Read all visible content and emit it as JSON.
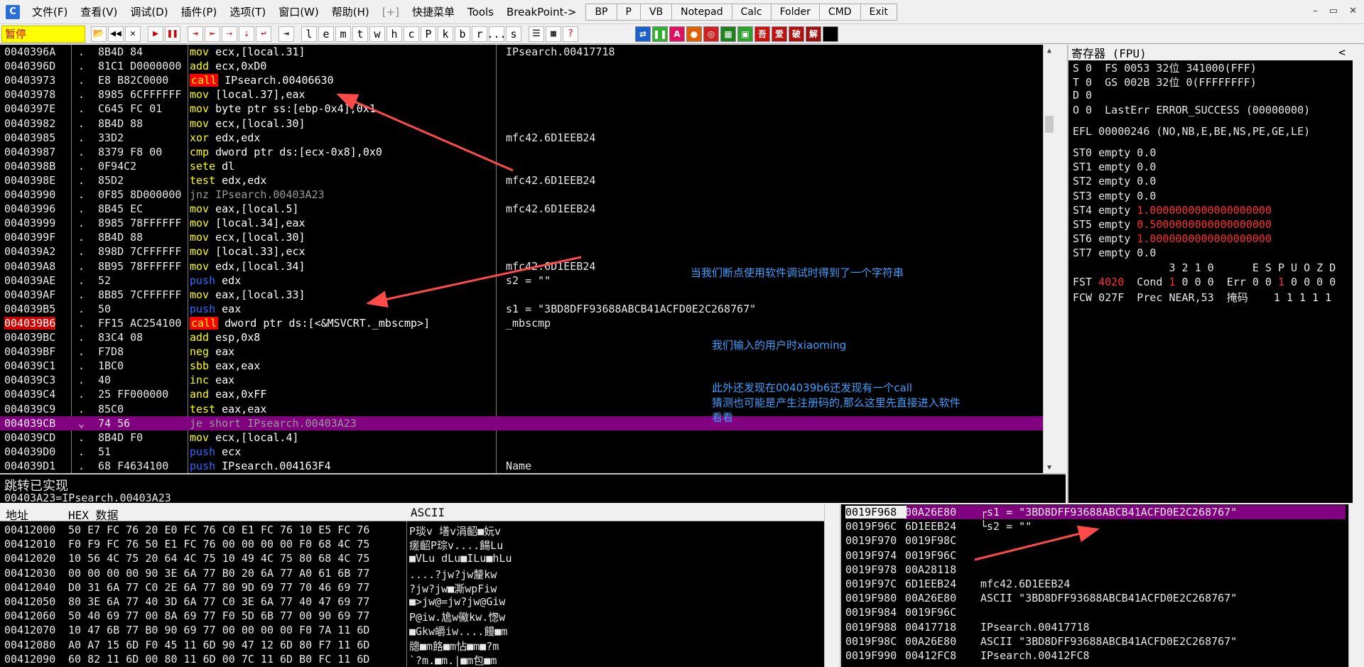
{
  "menubar": {
    "app_icon": "C",
    "items": [
      "文件(F)",
      "查看(V)",
      "调试(D)",
      "插件(P)",
      "选项(T)",
      "窗口(W)",
      "帮助(H)",
      "[+]",
      "快捷菜单",
      "Tools",
      "BreakPoint->"
    ],
    "quick_tabs": [
      "BP",
      "P",
      "VB",
      "Notepad",
      "Calc",
      "Folder",
      "CMD",
      "Exit"
    ],
    "window_controls": [
      "–",
      "▭",
      "✕"
    ]
  },
  "toolbar": {
    "status": "暂停",
    "buttons": [
      "📂",
      "◀◀",
      "✕",
      "▶",
      "❚❚",
      "⇥",
      "⇤",
      "⇢",
      "⇣",
      "↩",
      "⇥"
    ],
    "letters": [
      "l",
      "e",
      "m",
      "t",
      "w",
      "h",
      "c",
      "P",
      "k",
      "b",
      "r",
      "...",
      "s"
    ],
    "extra": [
      "☰",
      "▦",
      "?"
    ],
    "color_buttons": [
      {
        "label": "⇄",
        "color": "#1a5fd0"
      },
      {
        "label": "❚❚",
        "color": "#30b030"
      },
      {
        "label": "A",
        "color": "#e01060"
      },
      {
        "label": "●",
        "color": "#e06000"
      },
      {
        "label": "◎",
        "color": "#d02020"
      },
      {
        "label": "▦",
        "color": "#208020"
      },
      {
        "label": "▣",
        "color": "#30a030"
      },
      {
        "label": "吾",
        "color": "#d01010"
      },
      {
        "label": "爱",
        "color": "#c01010"
      },
      {
        "label": "破",
        "color": "#b01010"
      },
      {
        "label": "解",
        "color": "#a01010"
      },
      {
        "label": "",
        "color": "#000000"
      }
    ]
  },
  "disasm": {
    "rows": [
      {
        "addr": "0040396A",
        "mark": ".",
        "hex": "8B4D 84",
        "mn": "mov",
        "kind": "mov",
        "op": "ecx,[local.31]",
        "cmt": "IPsearch.00417718"
      },
      {
        "addr": "0040396D",
        "mark": ".",
        "hex": "81C1 D0000000",
        "mn": "add",
        "kind": "mov",
        "op": "ecx,0xD0",
        "cmt": ""
      },
      {
        "addr": "00403973",
        "mark": ".",
        "hex": "E8 B82C0000",
        "mn": "call",
        "kind": "call",
        "op": "IPsearch.00406630",
        "cmt": ""
      },
      {
        "addr": "00403978",
        "mark": ".",
        "hex": "8985 6CFFFFFF",
        "mn": "mov",
        "kind": "mov",
        "op": "[local.37],eax",
        "cmt": ""
      },
      {
        "addr": "0040397E",
        "mark": ".",
        "hex": "C645 FC 01",
        "mn": "mov",
        "kind": "mov",
        "op": "byte ptr ss:[ebp-0x4],0x1",
        "cmt": ""
      },
      {
        "addr": "00403982",
        "mark": ".",
        "hex": "8B4D 88",
        "mn": "mov",
        "kind": "mov",
        "op": "ecx,[local.30]",
        "cmt": ""
      },
      {
        "addr": "00403985",
        "mark": ".",
        "hex": "33D2",
        "mn": "xor",
        "kind": "mov",
        "op": "edx,edx",
        "cmt": "mfc42.6D1EEB24"
      },
      {
        "addr": "00403987",
        "mark": ".",
        "hex": "8379 F8 00",
        "mn": "cmp",
        "kind": "mov",
        "op": "dword ptr ds:[ecx-0x8],0x0",
        "cmt": ""
      },
      {
        "addr": "0040398B",
        "mark": ".",
        "hex": "0F94C2",
        "mn": "sete",
        "kind": "mov",
        "op": "dl",
        "cmt": ""
      },
      {
        "addr": "0040398E",
        "mark": ".",
        "hex": "85D2",
        "mn": "test",
        "kind": "mov",
        "op": "edx,edx",
        "cmt": "mfc42.6D1EEB24"
      },
      {
        "addr": "00403990",
        "mark": ".",
        "hex": "0F85 8D000000",
        "mn": "jnz",
        "kind": "jmp",
        "op": "IPsearch.00403A23",
        "cmt": ""
      },
      {
        "addr": "00403996",
        "mark": ".",
        "hex": "8B45 EC",
        "mn": "mov",
        "kind": "mov",
        "op": "eax,[local.5]",
        "cmt": "mfc42.6D1EEB24"
      },
      {
        "addr": "00403999",
        "mark": ".",
        "hex": "8985 78FFFFFF",
        "mn": "mov",
        "kind": "mov",
        "op": "[local.34],eax",
        "cmt": ""
      },
      {
        "addr": "0040399F",
        "mark": ".",
        "hex": "8B4D 88",
        "mn": "mov",
        "kind": "mov",
        "op": "ecx,[local.30]",
        "cmt": ""
      },
      {
        "addr": "004039A2",
        "mark": ".",
        "hex": "898D 7CFFFFFF",
        "mn": "mov",
        "kind": "mov",
        "op": "[local.33],ecx",
        "cmt": ""
      },
      {
        "addr": "004039A8",
        "mark": ".",
        "hex": "8B95 78FFFFFF",
        "mn": "mov",
        "kind": "mov",
        "op": "edx,[local.34]",
        "cmt": "mfc42.6D1EEB24"
      },
      {
        "addr": "004039AE",
        "mark": ".",
        "hex": "52",
        "mn": "push",
        "kind": "push",
        "op": "edx",
        "cmt": "s2 = \"\""
      },
      {
        "addr": "004039AF",
        "mark": ".",
        "hex": "8B85 7CFFFFFF",
        "mn": "mov",
        "kind": "mov",
        "op": "eax,[local.33]",
        "cmt": ""
      },
      {
        "addr": "004039B5",
        "mark": ".",
        "hex": "50",
        "mn": "push",
        "kind": "push",
        "op": "eax",
        "cmt": "s1 = \"3BD8DFF93688ABCB41ACFD0E2C268767\""
      },
      {
        "addr": "004039B6",
        "mark": ".",
        "hex": "FF15 AC254100",
        "mn": "call",
        "kind": "call",
        "op": "dword ptr ds:[<&MSVCRT._mbscmp>]",
        "cmt": "_mbscmp",
        "bp": true
      },
      {
        "addr": "004039BC",
        "mark": ".",
        "hex": "83C4 08",
        "mn": "add",
        "kind": "mov",
        "op": "esp,0x8",
        "cmt": ""
      },
      {
        "addr": "004039BF",
        "mark": ".",
        "hex": "F7D8",
        "mn": "neg",
        "kind": "mov",
        "op": "eax",
        "cmt": ""
      },
      {
        "addr": "004039C1",
        "mark": ".",
        "hex": "1BC0",
        "mn": "sbb",
        "kind": "mov",
        "op": "eax,eax",
        "cmt": ""
      },
      {
        "addr": "004039C3",
        "mark": ".",
        "hex": "40",
        "mn": "inc",
        "kind": "mov",
        "op": "eax",
        "cmt": ""
      },
      {
        "addr": "004039C4",
        "mark": ".",
        "hex": "25 FF000000",
        "mn": "and",
        "kind": "mov",
        "op": "eax,0xFF",
        "cmt": ""
      },
      {
        "addr": "004039C9",
        "mark": ".",
        "hex": "85C0",
        "mn": "test",
        "kind": "mov",
        "op": "eax,eax",
        "cmt": ""
      },
      {
        "addr": "004039CB",
        "mark": "⌄",
        "hex": "74 56",
        "mn": "je",
        "kind": "jmp",
        "op": "short IPsearch.00403A23",
        "cmt": "",
        "sel": true
      },
      {
        "addr": "004039CD",
        "mark": ".",
        "hex": "8B4D F0",
        "mn": "mov",
        "kind": "mov",
        "op": "ecx,[local.4]",
        "cmt": ""
      },
      {
        "addr": "004039D0",
        "mark": ".",
        "hex": "51",
        "mn": "push",
        "kind": "push",
        "op": "ecx",
        "cmt": ""
      },
      {
        "addr": "004039D1",
        "mark": ".",
        "hex": "68 F4634100",
        "mn": "push",
        "kind": "push",
        "op": "IPsearch.004163F4",
        "cmt": "Name"
      }
    ],
    "annotations": [
      "当我们断点使用软件调试时得到了一个字符串",
      "我们输入的用户时xiaoming",
      "此外还发现在004039b6还发现有一个call",
      "猜测也可能是产生注册码的,那么这里先直接进入软件",
      "看看"
    ]
  },
  "info": {
    "line1": "跳转已实现",
    "line2": "00403A23=IPsearch.00403A23"
  },
  "registers": {
    "title": "寄存器 (FPU)",
    "collapse": "<",
    "lines": [
      "S 0  FS 0053 32位 341000(FFF)",
      "T 0  GS 002B 32位 0(FFFFFFFF)",
      "D 0",
      "O 0  LastErr ERROR_SUCCESS (00000000)",
      "",
      "EFL 00000246 (NO,NB,E,BE,NS,PE,GE,LE)",
      "",
      "ST0 empty 0.0",
      "ST1 empty 0.0",
      "ST2 empty 0.0",
      "ST3 empty 0.0"
    ],
    "fpu_red": [
      {
        "label": "ST4 empty ",
        "value": "1.0000000000000000000"
      },
      {
        "label": "ST5 empty ",
        "value": "0.5000000000000000000"
      },
      {
        "label": "ST6 empty ",
        "value": "1.0000000000000000000"
      }
    ],
    "st7": "ST7 empty 0.0",
    "bits_header": "               3 2 1 0      E S P U O Z D",
    "fst": {
      "pre": "FST ",
      "red": "4020",
      "mid": "  Cond ",
      "red2": "1",
      "mid2": " 0 0 0  Err 0 0 ",
      "red3": "1",
      "post": " 0 0 0 0"
    },
    "fcw": "FCW 027F  Prec NEAR,53  掩码    1 1 1 1 1"
  },
  "dump": {
    "headers": {
      "addr": "地址",
      "hex": "HEX 数据",
      "ascii": "ASCII"
    },
    "rows": [
      {
        "addr": "00412000",
        "hex": "50 E7 FC 76 20 E0 FC 76 C0 E1 FC 76 10 E5 FC 76",
        "ascii": "P琰v 墡v涓齠■妧v"
      },
      {
        "addr": "00412010",
        "hex": "F0 F9 FC 76 50 E1 FC 76 00 00 00 00 F0 68 4C 75",
        "ascii": "瘥齠P琮v....餳Lu"
      },
      {
        "addr": "00412020",
        "hex": "10 56 4C 75 20 64 4C 75 10 49 4C 75 80 68 4C 75",
        "ascii": "■VLu dLu■ILu■hLu"
      },
      {
        "addr": "00412030",
        "hex": "00 00 00 00 90 3E 6A 77 B0 20 6A 77 A0 61 6B 77",
        "ascii": "....?jw?jw釐kw"
      },
      {
        "addr": "00412040",
        "hex": "D0 31 6A 77 C0 2E 6A 77 80 9D 69 77 70 46 69 77",
        "ascii": "?jw?jw■澌wpFiw"
      },
      {
        "addr": "00412050",
        "hex": "80 3E 6A 77 40 3D 6A 77 C0 3E 6A 77 40 47 69 77",
        "ascii": "■>jw@=jw?jw@Giw"
      },
      {
        "addr": "00412060",
        "hex": "50 40 69 77 00 8A 69 77 F0 5D 6B 77 00 90 69 77",
        "ascii": "P@iw.尯w鰴kw.愡w"
      },
      {
        "addr": "00412070",
        "hex": "10 47 6B 77 B0 90 69 77 00 00 00 00 F0 7A 11 6D",
        "ascii": "■Gkw皭iw....饅■m"
      },
      {
        "addr": "00412080",
        "hex": "A0 A7 15 6D F0 45 11 6D 90 47 12 6D 80 F7 11 6D",
        "ascii": "牕■m餎■m怗■m■?m"
      },
      {
        "addr": "00412090",
        "hex": "60 82 11 6D 00 80 11 6D 00 7C 11 6D B0 FC 11 6D",
        "ascii": "`?m.■m.|■m包■m"
      }
    ]
  },
  "stack": {
    "rows": [
      {
        "addr": "0019F968",
        "val": "00A26E80",
        "cmt": "┌s1 = \"3BD8DFF93688ABCB41ACFD0E2C268767\"",
        "top": true,
        "sel": true
      },
      {
        "addr": "0019F96C",
        "val": "6D1EEB24",
        "cmt": "└s2 = \"\""
      },
      {
        "addr": "0019F970",
        "val": "0019F98C",
        "cmt": ""
      },
      {
        "addr": "0019F974",
        "val": "0019F96C",
        "cmt": ""
      },
      {
        "addr": "0019F978",
        "val": "00A28118",
        "cmt": ""
      },
      {
        "addr": "0019F97C",
        "val": "6D1EEB24",
        "cmt": "mfc42.6D1EEB24"
      },
      {
        "addr": "0019F980",
        "val": "00A26E80",
        "cmt": "ASCII \"3BD8DFF93688ABCB41ACFD0E2C268767\""
      },
      {
        "addr": "0019F984",
        "val": "0019F96C",
        "cmt": ""
      },
      {
        "addr": "0019F988",
        "val": "00417718",
        "cmt": "IPsearch.00417718"
      },
      {
        "addr": "0019F98C",
        "val": "00A26E80",
        "cmt": "ASCII \"3BD8DFF93688ABCB41ACFD0E2C268767\""
      },
      {
        "addr": "0019F990",
        "val": "00412FC8",
        "cmt": "IPsearch.00412FC8"
      }
    ]
  }
}
